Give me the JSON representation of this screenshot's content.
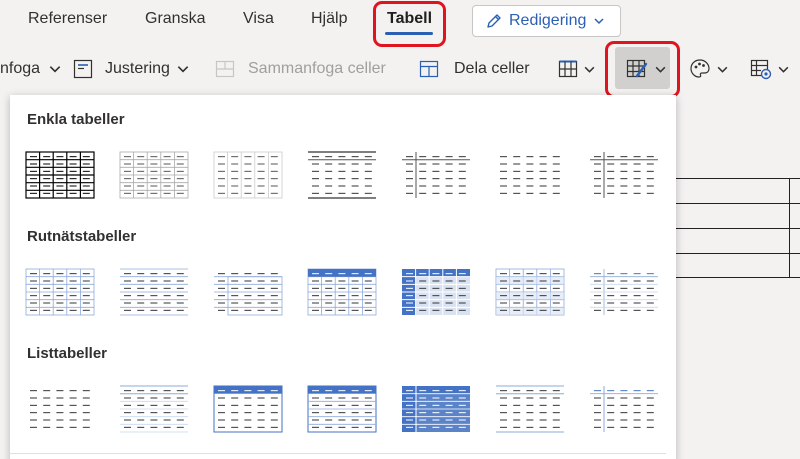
{
  "tabs": [
    {
      "label": "Referenser"
    },
    {
      "label": "Granska"
    },
    {
      "label": "Visa"
    },
    {
      "label": "Hjälp"
    },
    {
      "label": "Tabell",
      "active": true
    }
  ],
  "mode_button": {
    "label": "Redigering"
  },
  "commands": {
    "merge_partial": "nfoga",
    "alignment": "Justering",
    "merge_cells": "Sammanfoga celler",
    "split_cells": "Dela celler"
  },
  "gallery": {
    "sections": [
      {
        "title": "Enkla tabeller"
      },
      {
        "title": "Rutnätstabeller"
      },
      {
        "title": "Listtabeller"
      }
    ]
  },
  "colors": {
    "accent": "#2b5fb4",
    "highlight": "#e0141e",
    "style_blue": "#4472c4",
    "style_light_blue": "#d9e2f3"
  },
  "icons": [
    "pen-icon",
    "chevron-down-icon",
    "alignment-icon",
    "merge-cells-icon",
    "split-cells-icon",
    "table-grid-icon",
    "table-styles-icon",
    "palette-icon",
    "table-settings-icon"
  ]
}
